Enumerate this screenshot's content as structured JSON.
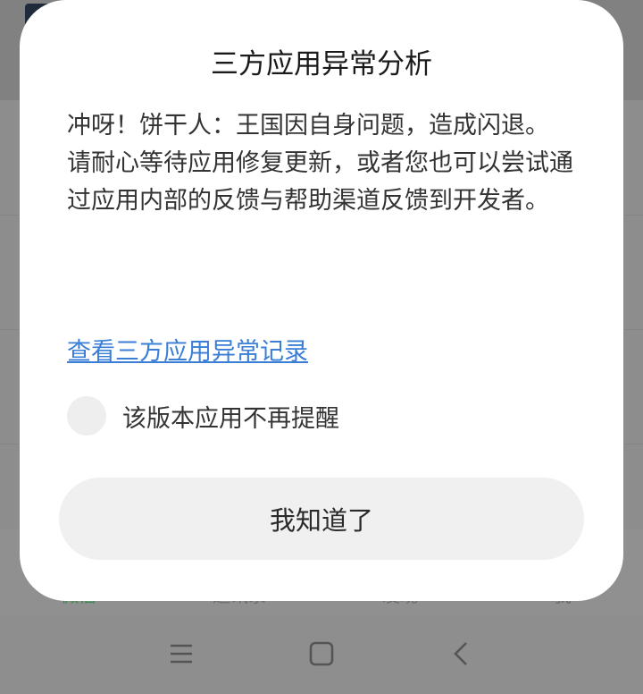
{
  "background_app": {
    "tabs": [
      "微信",
      "通讯录",
      "发现",
      "我"
    ]
  },
  "dialog": {
    "title": "三方应用异常分析",
    "message_line1": "冲呀！饼干人：王国因自身问题，造成闪退。",
    "message_line2": "请耐心等待应用修复更新，或者您也可以尝试通过应用内部的反馈与帮助渠道反馈到开发者。",
    "link_text": "查看三方应用异常记录",
    "checkbox_label": "该版本应用不再提醒",
    "checkbox_checked": false,
    "confirm_button": "我知道了"
  },
  "navigation_bar": {
    "icons": [
      "menu-icon",
      "home-icon",
      "back-icon"
    ]
  },
  "colors": {
    "link": "#3a7ed6",
    "dialog_bg": "#ffffff",
    "button_bg": "#f0f0f0",
    "active_tab": "#3f8a4f"
  }
}
